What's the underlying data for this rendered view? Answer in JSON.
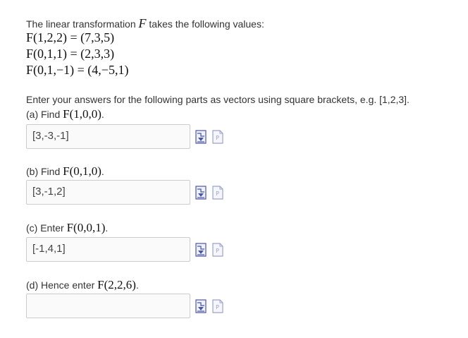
{
  "intro": {
    "prefix": "The linear transformation ",
    "symbol": "F",
    "suffix": " takes the following values:"
  },
  "equations": [
    "F(1,2,2) = (7,3,5)",
    "F(0,1,1) = (2,3,3)",
    "F(0,1,−1) = (4,−5,1)"
  ],
  "instructions": "Enter your answers for the following parts as vectors using square brackets, e.g. [1,2,3].",
  "parts": [
    {
      "label": "(a) Find ",
      "math": "F(1,0,0)",
      "end": ".",
      "value": "[3,-3,-1]"
    },
    {
      "label": "(b) Find ",
      "math": "F(0,1,0)",
      "end": ".",
      "value": "[3,-1,2]"
    },
    {
      "label": "(c) Enter ",
      "math": "F(0,0,1)",
      "end": ".",
      "value": "[-1,4,1]"
    },
    {
      "label": "(d) Hence enter ",
      "math": "F(2,2,6)",
      "end": ".",
      "value": ""
    }
  ],
  "icons": {
    "preview": "preview-icon",
    "help": "help-icon"
  },
  "colors": {
    "text": "#333333",
    "input_border": "#cccccc",
    "input_bg": "#fafafa",
    "preview_icon": "#4a56a6",
    "help_icon": "#9aa4c8"
  }
}
